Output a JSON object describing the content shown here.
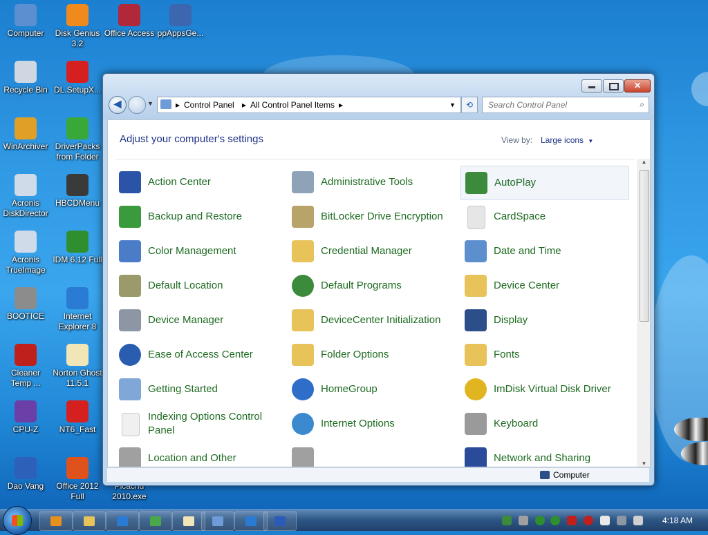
{
  "desktop": {
    "icons": [
      {
        "label": "Computer",
        "color": "#5b8fd0"
      },
      {
        "label": "Disk Genius 3.2",
        "color": "#f08a1c"
      },
      {
        "label": "Office Access",
        "color": "#b0283a"
      },
      {
        "label": "ppAppsGe...",
        "color": "#3c66b0"
      },
      {
        "label": "Recycle Bin",
        "color": "#cfd8e2"
      },
      {
        "label": "DL.SetupX...",
        "color": "#d61f1f"
      },
      {
        "label": "WinArchiver",
        "color": "#e0a028"
      },
      {
        "label": "DriverPacks from Folder",
        "color": "#38a838"
      },
      {
        "label": "Acronis DiskDirector",
        "color": "#cfdbe8"
      },
      {
        "label": "HBCDMenu",
        "color": "#3a3a3a"
      },
      {
        "label": "Acronis TrueImage",
        "color": "#cfdbe8"
      },
      {
        "label": "IDM 6.12 Full",
        "color": "#2f8f2f"
      },
      {
        "label": "BOOTICE",
        "color": "#8c8c8c"
      },
      {
        "label": "Internet Explorer 8",
        "color": "#2a7bd4"
      },
      {
        "label": "Cleaner Temp ...",
        "color": "#c0201c"
      },
      {
        "label": "Norton Ghost 11.5.1",
        "color": "#f2e6b8"
      },
      {
        "label": "CPU-Z",
        "color": "#6a3fa8"
      },
      {
        "label": "NT6_Fast",
        "color": "#d61f1f"
      },
      {
        "label": "Dao Vang",
        "color": "#2d60b8"
      },
      {
        "label": "Office 2012 Full",
        "color": "#e0521c"
      },
      {
        "label": "Picacnu 2010.exe",
        "color": "#3e7dc2"
      }
    ]
  },
  "window": {
    "address": {
      "crumbs": [
        "Control Panel",
        "All Control Panel Items"
      ]
    },
    "search": {
      "placeholder": "Search Control Panel"
    },
    "header": {
      "title": "Adjust your computer's settings",
      "view_by_label": "View by:",
      "view_by_value": "Large icons"
    },
    "items": [
      {
        "label": "Action Center",
        "icon": "flag-icon",
        "color": "#2b54a8"
      },
      {
        "label": "Administrative Tools",
        "icon": "admin-tools-icon",
        "color": "#8fa3b8"
      },
      {
        "label": "AutoPlay",
        "icon": "autoplay-icon",
        "color": "#3c8a3c"
      },
      {
        "label": "Backup and Restore",
        "icon": "backup-icon",
        "color": "#3b9a3b"
      },
      {
        "label": "BitLocker Drive Encryption",
        "icon": "bitlocker-icon",
        "color": "#b8a46a"
      },
      {
        "label": "CardSpace",
        "icon": "cardspace-icon",
        "color": "#e6e6e6"
      },
      {
        "label": "Color Management",
        "icon": "color-management-icon",
        "color": "#4a7cc8"
      },
      {
        "label": "Credential Manager",
        "icon": "folder-icon",
        "color": "#e8c35a"
      },
      {
        "label": "Date and Time",
        "icon": "calendar-icon",
        "color": "#5d8fcf"
      },
      {
        "label": "Default Location",
        "icon": "default-location-icon",
        "color": "#9a9a6a"
      },
      {
        "label": "Default Programs",
        "icon": "default-programs-icon",
        "color": "#3c8a3c"
      },
      {
        "label": "Device Center",
        "icon": "folder-icon",
        "color": "#e8c35a"
      },
      {
        "label": "Device Manager",
        "icon": "device-manager-icon",
        "color": "#8c96a4"
      },
      {
        "label": "DeviceCenter Initialization",
        "icon": "folder-icon",
        "color": "#e8c35a"
      },
      {
        "label": "Display",
        "icon": "display-icon",
        "color": "#2c4f8a"
      },
      {
        "label": "Ease of Access Center",
        "icon": "ease-of-access-icon",
        "color": "#2a5db0"
      },
      {
        "label": "Folder Options",
        "icon": "folder-options-icon",
        "color": "#e8c35a"
      },
      {
        "label": "Fonts",
        "icon": "fonts-icon",
        "color": "#e8c35a"
      },
      {
        "label": "Getting Started",
        "icon": "getting-started-icon",
        "color": "#7fa8d8"
      },
      {
        "label": "HomeGroup",
        "icon": "homegroup-icon",
        "color": "#2f6ec8"
      },
      {
        "label": "ImDisk Virtual Disk Driver",
        "icon": "disk-icon",
        "color": "#e0b520"
      },
      {
        "label": "Indexing Options Control Panel",
        "icon": "document-icon",
        "color": "#f0f0f0"
      },
      {
        "label": "Internet Options",
        "icon": "globe-icon",
        "color": "#3b8ad0"
      },
      {
        "label": "Keyboard",
        "icon": "keyboard-icon",
        "color": "#9a9a9a"
      },
      {
        "label": "Location and Other",
        "icon": "location-icon",
        "color": "#a0a0a0"
      },
      {
        "label": "",
        "icon": "mouse-icon",
        "color": "#a0a0a0"
      },
      {
        "label": "Network and Sharing",
        "icon": "network-icon",
        "color": "#2a4a9a"
      }
    ],
    "status": {
      "text": "Computer"
    }
  },
  "taskbar": {
    "buttons": [
      {
        "name": "media-player",
        "color": "#e8901c"
      },
      {
        "name": "explorer",
        "color": "#e8c35a"
      },
      {
        "name": "internet-explorer",
        "color": "#2a7bd4"
      },
      {
        "name": "app-tools",
        "color": "#4aa84a"
      },
      {
        "name": "norton-ghost",
        "color": "#f2e6b8"
      },
      {
        "name": "control-panel",
        "color": "#6f9bd6"
      },
      {
        "name": "internet-explorer-2",
        "color": "#2a7bd4"
      },
      {
        "name": "word",
        "color": "#2b5ab8"
      }
    ],
    "clock": "4:18 AM"
  }
}
